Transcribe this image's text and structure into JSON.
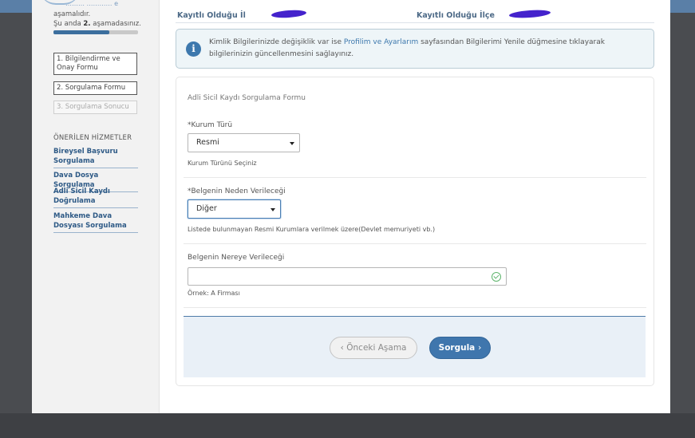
{
  "header": {
    "logo_text": "……… ………… e",
    "registered_province_label": "Kayıtlı Olduğu İl",
    "registered_district_label": "Kayıtlı Olduğu İlçe"
  },
  "sidebar": {
    "step_text_line1": "aşamalıdır.",
    "step_text_prefix": "Şu anda",
    "step_current": "2.",
    "step_text_suffix": "aşamadasınız.",
    "progress_fraction": 0.66,
    "steps": [
      {
        "label": "1. Bilgilendirme ve Onay Formu",
        "state": "done"
      },
      {
        "label": "2. Sorgulama Formu",
        "state": "active"
      },
      {
        "label": "3. Sorgulama Sonucu",
        "state": "inactive"
      }
    ],
    "services_title": "ÖNERİLEN HİZMETLER",
    "services": [
      {
        "label": "Bireysel Başvuru Sorgulama"
      },
      {
        "label": "Dava Dosya Sorgulama"
      },
      {
        "label": "Adli Sicil Kaydı Doğrulama"
      },
      {
        "label": "Mahkeme Dava Dosyası Sorgulama"
      }
    ]
  },
  "info": {
    "icon": "info-icon",
    "text_before": "Kimlik Bilgilerinizde değişiklik var ise",
    "link_text": "Profilim ve Ayarlarım",
    "text_after": "sayfasından Bilgilerimi Yenile düğmesine tıklayarak bilgilerinizin güncellenmesini sağlayınız."
  },
  "form": {
    "title": "Adli Sicil Kaydı Sorgulama Formu",
    "institution_type": {
      "label": "*Kurum Türü",
      "value": "Resmi",
      "help": "Kurum Türünü Seçiniz"
    },
    "reason": {
      "label": "*Belgenin Neden Verileceği",
      "value": "Diğer",
      "help": "Listede bulunmayan Resmi Kurumlara verilmek üzere(Devlet memuriyeti vb.)"
    },
    "destination": {
      "label": "Belgenin Nereye Verileceği",
      "value": "",
      "help": "Örnek: A Firması"
    },
    "back_button": "Önceki Aşama",
    "submit_button": "Sorgula"
  },
  "colors": {
    "accent": "#3f76ad",
    "link": "#2e5a86",
    "info_bg": "#eef5f8",
    "valid": "#5fb56d"
  }
}
